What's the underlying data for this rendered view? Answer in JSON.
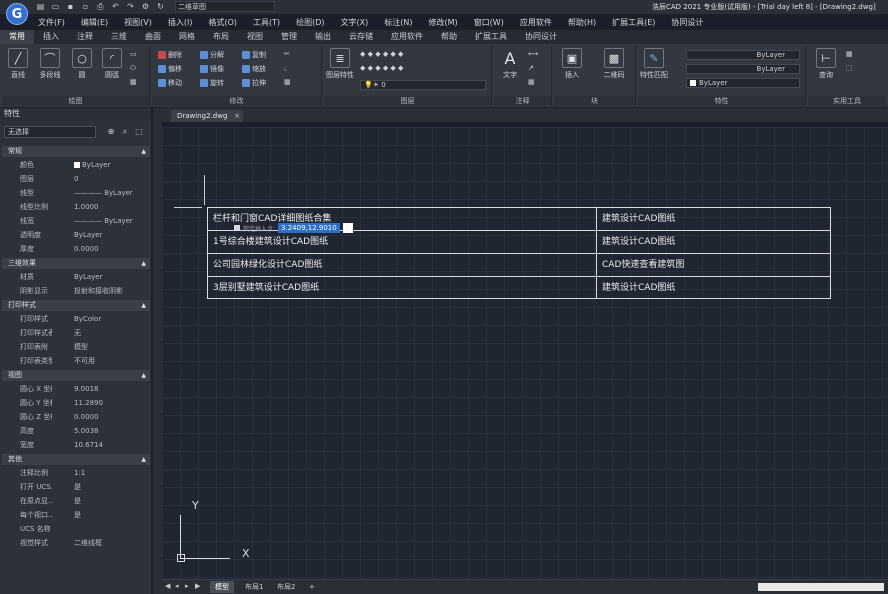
{
  "app": {
    "logo_letter": "G",
    "title": "浩辰CAD 2021 专业版(试用版) - [Trial day left 8] - [Drawing2.dwg]",
    "quick_access_name": "二维草图"
  },
  "menu_items": [
    "文件(F)",
    "编辑(E)",
    "视图(V)",
    "插入(I)",
    "格式(O)",
    "工具(T)",
    "绘图(D)",
    "文字(X)",
    "标注(N)",
    "修改(M)",
    "窗口(W)",
    "应用软件",
    "帮助(H)",
    "扩展工具(E)",
    "协同设计"
  ],
  "ribbon_tabs": [
    {
      "label": "常用",
      "active": true
    },
    {
      "label": "插入",
      "active": false
    },
    {
      "label": "注释",
      "active": false
    },
    {
      "label": "三维",
      "active": false
    },
    {
      "label": "曲面",
      "active": false
    },
    {
      "label": "网格",
      "active": false
    },
    {
      "label": "布局",
      "active": false
    },
    {
      "label": "视图",
      "active": false
    },
    {
      "label": "管理",
      "active": false
    },
    {
      "label": "输出",
      "active": false
    },
    {
      "label": "云存储",
      "active": false
    },
    {
      "label": "应用软件",
      "active": false
    },
    {
      "label": "帮助",
      "active": false
    },
    {
      "label": "扩展工具",
      "active": false
    },
    {
      "label": "协同设计",
      "active": false
    }
  ],
  "ribbon": {
    "draw": {
      "label": "绘图",
      "line": "直线",
      "polyline": "多段线",
      "circle": "圆",
      "arc": "圆弧"
    },
    "modify": {
      "label": "修改",
      "items": [
        "删除",
        "分解",
        "偏移",
        "镜像",
        "复制",
        "缩放",
        "旋转",
        "拉伸",
        "阵列",
        "移动",
        "修剪",
        "圆角"
      ]
    },
    "layer": {
      "label": "图层",
      "layer_props": "图层特性"
    },
    "annotation": {
      "label": "注释",
      "text": "文字"
    },
    "block": {
      "label": "块",
      "insert": "插入",
      "qrcode": "二维码"
    },
    "properties": {
      "label": "特性",
      "match": "特性匹配",
      "color": "ByLayer",
      "linetype": "ByLayer",
      "lineweight": "ByLayer"
    },
    "utilities": {
      "label": "实用工具",
      "query": "查询"
    }
  },
  "properties_panel": {
    "title": "特性",
    "selection": "无选择",
    "sections": [
      {
        "name": "常规",
        "rows": [
          {
            "k": "颜色",
            "v": "ByLayer",
            "swatch": true
          },
          {
            "k": "图层",
            "v": "0"
          },
          {
            "k": "线型",
            "v": "———— ByLayer"
          },
          {
            "k": "线型比例",
            "v": "1.0000"
          },
          {
            "k": "线宽",
            "v": "———— ByLayer"
          },
          {
            "k": "透明度",
            "v": "ByLayer"
          },
          {
            "k": "厚度",
            "v": "0.0000"
          }
        ]
      },
      {
        "name": "三维效果",
        "rows": [
          {
            "k": "材质",
            "v": "ByLayer"
          },
          {
            "k": "阴影显示",
            "v": "投射和接收阴影"
          }
        ]
      },
      {
        "name": "打印样式",
        "rows": [
          {
            "k": "打印样式",
            "v": "ByColor"
          },
          {
            "k": "打印样式表",
            "v": "无"
          },
          {
            "k": "打印表附",
            "v": "模型"
          },
          {
            "k": "打印表类型",
            "v": "不可用"
          }
        ]
      },
      {
        "name": "视图",
        "rows": [
          {
            "k": "圆心 X 坐标",
            "v": "9.0018"
          },
          {
            "k": "圆心 Y 坐标",
            "v": "11.2890"
          },
          {
            "k": "圆心 Z 坐标",
            "v": "0.0000"
          },
          {
            "k": "高度",
            "v": "5.0038"
          },
          {
            "k": "宽度",
            "v": "10.6714"
          }
        ]
      },
      {
        "name": "其他",
        "rows": [
          {
            "k": "注释比例",
            "v": "1:1"
          },
          {
            "k": "打开 UCS...",
            "v": "是"
          },
          {
            "k": "在原点显...",
            "v": "是"
          },
          {
            "k": "每个视口...",
            "v": "是"
          },
          {
            "k": "UCS 名称",
            "v": ""
          },
          {
            "k": "视觉样式",
            "v": "二维线框"
          }
        ]
      }
    ]
  },
  "document_tab": "Drawing2.dwg",
  "cad_table": [
    [
      "栏杆和门窗CAD详细图纸合集",
      "建筑设计CAD图纸"
    ],
    [
      "1号综合楼建筑设计CAD图纸",
      "建筑设计CAD图纸"
    ],
    [
      "公司园林绿化设计CAD图纸",
      "CAD快速查看建筑图"
    ],
    [
      "3层别墅建筑设计CAD图纸",
      "建筑设计CAD图纸"
    ]
  ],
  "input_tip": {
    "label": "指定插入点:",
    "value": "3.2409,12.9010"
  },
  "ucs": {
    "x": "X",
    "y": "Y"
  },
  "layout_tabs": [
    {
      "label": "模型",
      "active": true
    },
    {
      "label": "布局1",
      "active": false
    },
    {
      "label": "布局2",
      "active": false
    },
    {
      "label": "+",
      "active": false
    }
  ]
}
